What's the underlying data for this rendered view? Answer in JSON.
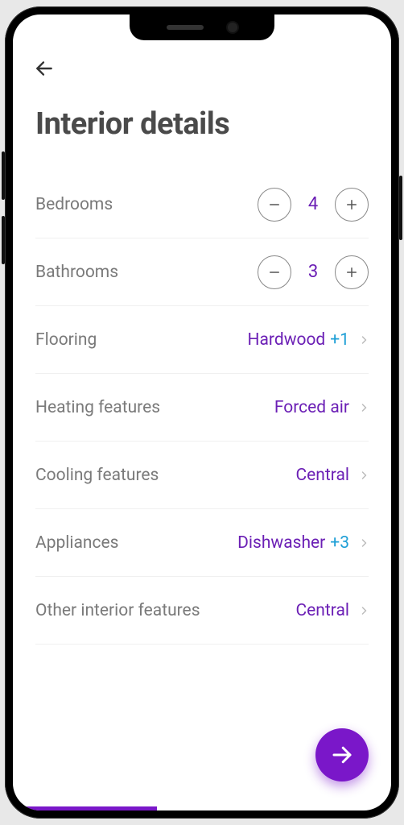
{
  "page": {
    "title": "Interior details"
  },
  "steppers": {
    "bedrooms": {
      "label": "Bedrooms",
      "value": "4"
    },
    "bathrooms": {
      "label": "Bathrooms",
      "value": "3"
    }
  },
  "selects": {
    "flooring": {
      "label": "Flooring",
      "value": "Hardwood",
      "extra": "+1"
    },
    "heating": {
      "label": "Heating features",
      "value": "Forced air",
      "extra": ""
    },
    "cooling": {
      "label": "Cooling features",
      "value": "Central",
      "extra": ""
    },
    "appliances": {
      "label": "Appliances",
      "value": "Dishwasher",
      "extra": "+3"
    },
    "other": {
      "label": "Other interior features",
      "value": "Central",
      "extra": ""
    }
  }
}
